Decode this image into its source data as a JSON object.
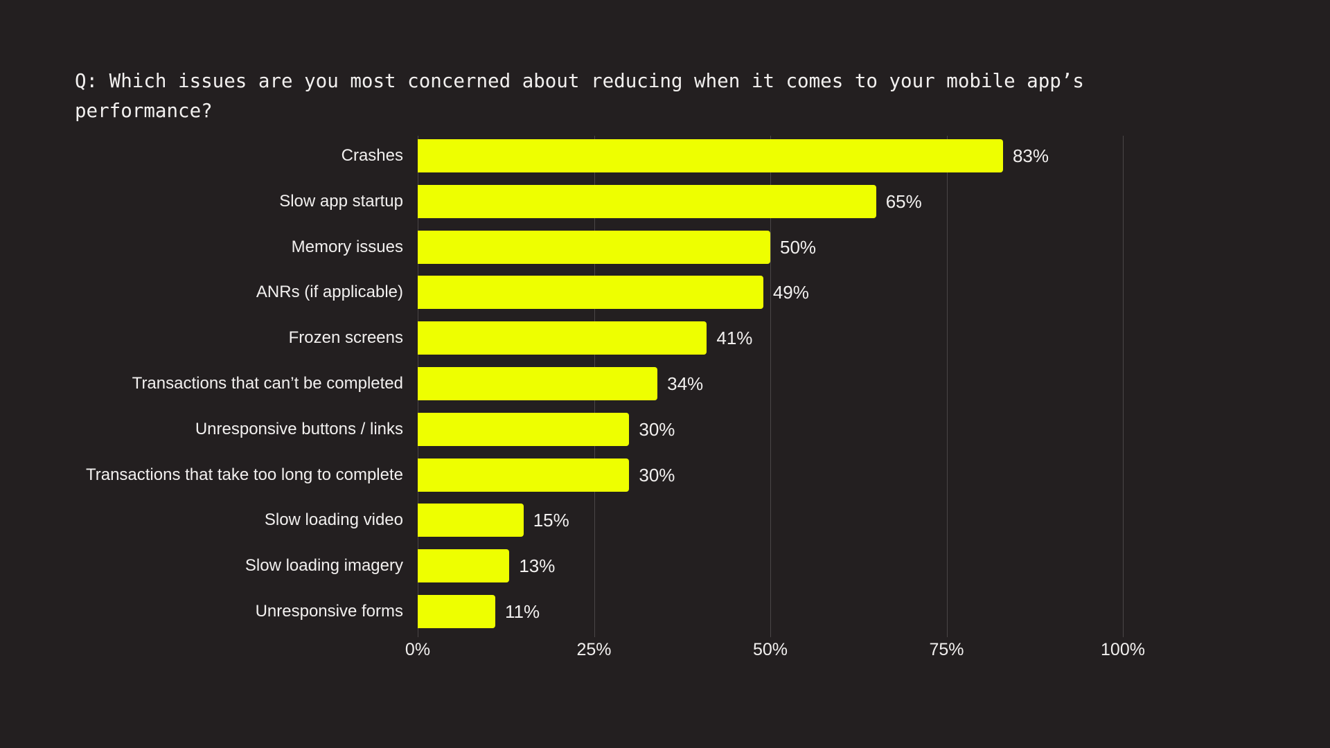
{
  "title": {
    "line1": "Q: Which issues are you most concerned about reducing when it comes to your mobile app’s",
    "line2": "performance?",
    "full": "Q: Which issues are you most concerned about reducing when it comes to your mobile app’s performance?"
  },
  "colors": {
    "background": "#231f20",
    "bar": "#eeff00",
    "text": "#f2f0ef",
    "gridline": "#4a4647"
  },
  "chart_data": {
    "type": "bar",
    "orientation": "horizontal",
    "title": "Q: Which issues are you most concerned about reducing when it comes to your mobile app’s performance?",
    "xlabel": "",
    "ylabel": "",
    "xlim": [
      0,
      100
    ],
    "grid": true,
    "legend": null,
    "unit": "%",
    "xticks": [
      {
        "value": 0,
        "label": "0%"
      },
      {
        "value": 25,
        "label": "25%"
      },
      {
        "value": 50,
        "label": "50%"
      },
      {
        "value": 75,
        "label": "75%"
      },
      {
        "value": 100,
        "label": "100%"
      }
    ],
    "categories": [
      "Crashes",
      "Slow app startup",
      "Memory issues",
      "ANRs (if applicable)",
      "Frozen screens",
      "Transactions that can’t be completed",
      "Unresponsive buttons / links",
      "Transactions that take too long to complete",
      "Slow loading video",
      "Slow loading imagery",
      "Unresponsive forms"
    ],
    "values": [
      83,
      65,
      50,
      49,
      41,
      34,
      30,
      30,
      15,
      13,
      11
    ],
    "value_labels": [
      "83%",
      "65%",
      "50%",
      "49%",
      "41%",
      "34%",
      "30%",
      "30%",
      "15%",
      "13%",
      "11%"
    ],
    "bars": [
      {
        "label": "Crashes",
        "value": 83,
        "value_label": "83%"
      },
      {
        "label": "Slow app startup",
        "value": 65,
        "value_label": "65%"
      },
      {
        "label": "Memory issues",
        "value": 50,
        "value_label": "50%"
      },
      {
        "label": "ANRs (if applicable)",
        "value": 49,
        "value_label": "49%"
      },
      {
        "label": "Frozen screens",
        "value": 41,
        "value_label": "41%"
      },
      {
        "label": "Transactions that can’t be completed",
        "value": 34,
        "value_label": "34%"
      },
      {
        "label": "Unresponsive buttons / links",
        "value": 30,
        "value_label": "30%"
      },
      {
        "label": "Transactions that take too long to complete",
        "value": 30,
        "value_label": "30%"
      },
      {
        "label": "Slow loading video",
        "value": 15,
        "value_label": "15%"
      },
      {
        "label": "Slow loading imagery",
        "value": 13,
        "value_label": "13%"
      },
      {
        "label": "Unresponsive forms",
        "value": 11,
        "value_label": "11%"
      }
    ]
  }
}
